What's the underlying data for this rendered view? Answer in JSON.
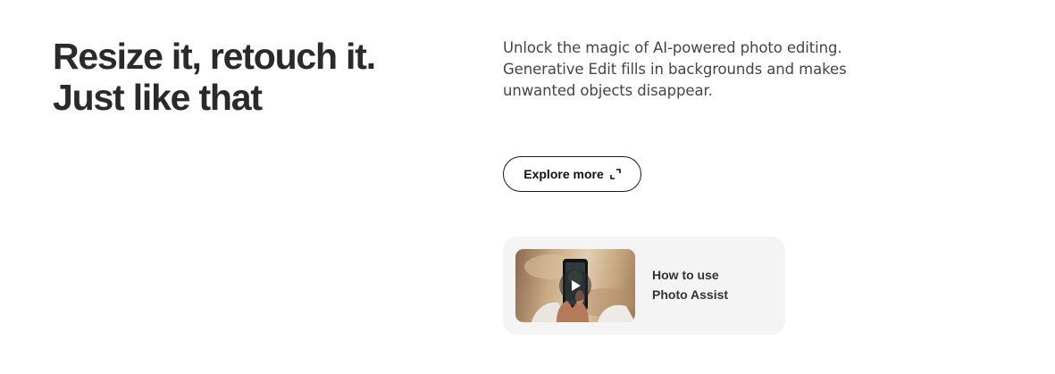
{
  "hero": {
    "headline_line1": "Resize it, retouch it.",
    "headline_line2": "Just like that",
    "description": "Unlock the magic of AI-powered photo editing. Generative Edit fills in backgrounds and makes unwanted objects disappear."
  },
  "explore_button": {
    "label": "Explore more",
    "icon": "expand-icon"
  },
  "video_card": {
    "title_line1": "How to use",
    "title_line2": "Photo Assist",
    "thumbnail": "phone-in-hand-thumbnail",
    "play_icon": "play-icon"
  },
  "colors": {
    "background": "#ffffff",
    "headline": "#2a2a2a",
    "body_text": "#454545",
    "card_background": "#f4f4f4",
    "button_border": "#1a1a1a"
  }
}
